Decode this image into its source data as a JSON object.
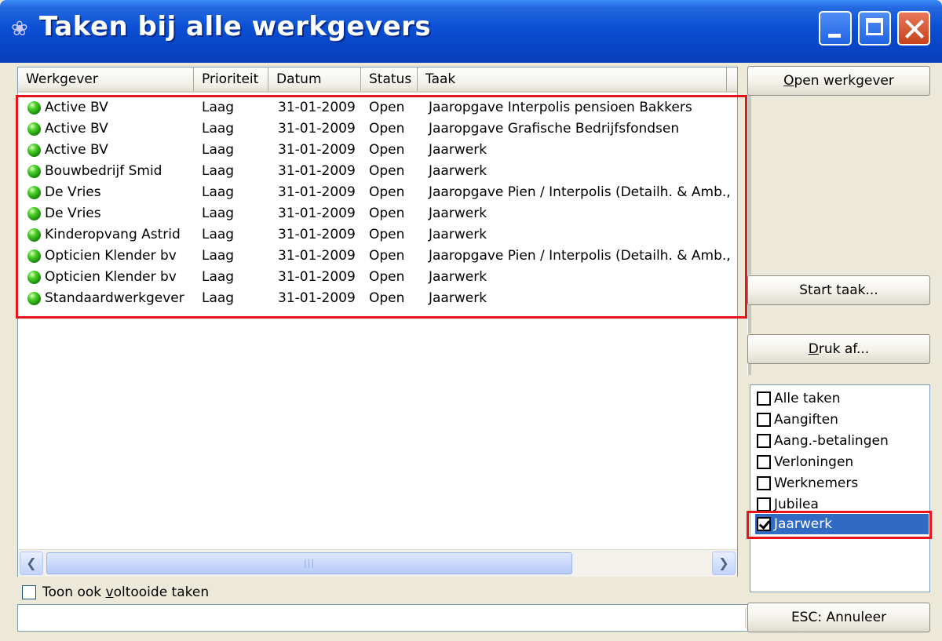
{
  "window": {
    "title": "Taken bij alle werkgevers",
    "icon": "app-logo-icon"
  },
  "list": {
    "columns": [
      "Werkgever",
      "Prioriteit",
      "Datum",
      "Status",
      "Taak"
    ],
    "rows": [
      {
        "werkgever": "Active BV",
        "prioriteit": "Laag",
        "datum": "31-01-2009",
        "status": "Open",
        "taak": "Jaaropgave Interpolis pensioen Bakkers"
      },
      {
        "werkgever": "Active BV",
        "prioriteit": "Laag",
        "datum": "31-01-2009",
        "status": "Open",
        "taak": "Jaaropgave Grafische Bedrijfsfondsen"
      },
      {
        "werkgever": "Active BV",
        "prioriteit": "Laag",
        "datum": "31-01-2009",
        "status": "Open",
        "taak": "Jaarwerk"
      },
      {
        "werkgever": "Bouwbedrijf Smid",
        "prioriteit": "Laag",
        "datum": "31-01-2009",
        "status": "Open",
        "taak": "Jaarwerk"
      },
      {
        "werkgever": "De Vries",
        "prioriteit": "Laag",
        "datum": "31-01-2009",
        "status": "Open",
        "taak": "Jaaropgave Pien / Interpolis (Detailh. & Amb.,"
      },
      {
        "werkgever": "De Vries",
        "prioriteit": "Laag",
        "datum": "31-01-2009",
        "status": "Open",
        "taak": "Jaarwerk"
      },
      {
        "werkgever": "Kinderopvang Astrid",
        "prioriteit": "Laag",
        "datum": "31-01-2009",
        "status": "Open",
        "taak": "Jaarwerk"
      },
      {
        "werkgever": "Opticien Klender bv",
        "prioriteit": "Laag",
        "datum": "31-01-2009",
        "status": "Open",
        "taak": "Jaaropgave Pien / Interpolis (Detailh. & Amb.,"
      },
      {
        "werkgever": "Opticien Klender bv",
        "prioriteit": "Laag",
        "datum": "31-01-2009",
        "status": "Open",
        "taak": "Jaarwerk"
      },
      {
        "werkgever": "Standaardwerkgever",
        "prioriteit": "Laag",
        "datum": "31-01-2009",
        "status": "Open",
        "taak": "Jaarwerk"
      }
    ],
    "status_icon": "green-status-dot-icon"
  },
  "buttons": {
    "open_werkgever": {
      "accel": "O",
      "rest": "pen werkgever"
    },
    "start_taak": "Start taak...",
    "druk_af": {
      "accel": "D",
      "rest": "ruk af..."
    },
    "esc": "ESC: Annuleer"
  },
  "filters": [
    {
      "label": "Alle taken",
      "checked": false
    },
    {
      "label": "Aangiften",
      "checked": false
    },
    {
      "label": "Aang.-betalingen",
      "checked": false
    },
    {
      "label": "Verloningen",
      "checked": false
    },
    {
      "label": "Werknemers",
      "checked": false
    },
    {
      "label": "Jubilea",
      "checked": false
    },
    {
      "label": "Jaarwerk",
      "checked": true,
      "selected": true
    }
  ],
  "bottom": {
    "show_done": {
      "before": "Toon ook ",
      "accel": "v",
      "after": "oltooide taken",
      "checked": false
    },
    "combo_value": ""
  },
  "colors": {
    "highlight_box": "#e8141c",
    "selection": "#316ac5",
    "titlebar": "#0a4fd4"
  }
}
